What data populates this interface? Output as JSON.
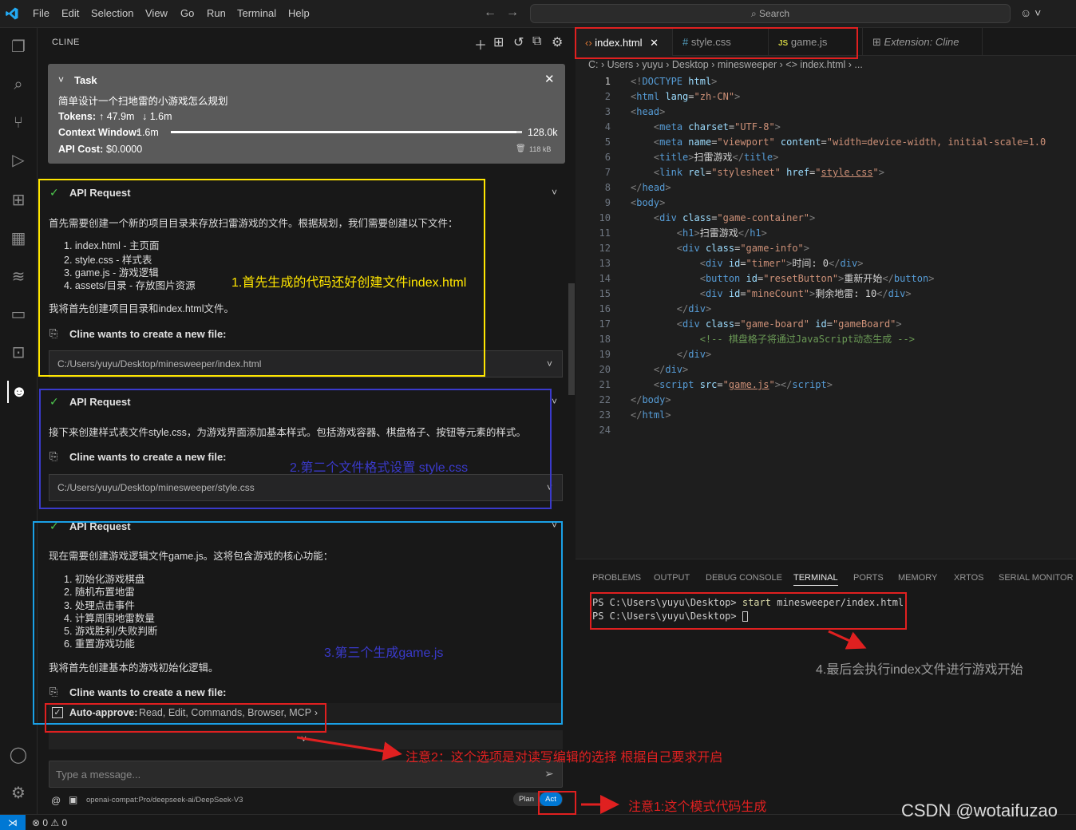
{
  "menu": [
    "File",
    "Edit",
    "Selection",
    "View",
    "Go",
    "Run",
    "Terminal",
    "Help"
  ],
  "search": {
    "label": "Search"
  },
  "sidebar": {
    "title": "CLINE"
  },
  "task": {
    "header": "Task",
    "title": "简单设计一个扫地雷的小游戏怎么规划",
    "tokens_label": "Tokens:",
    "tokens_up": "↑ 47.9m",
    "tokens_down": "↓ 1.6m",
    "context_label": "Context Window:",
    "context_used": "1.6m",
    "context_total": "128.0k",
    "context_fraction": 0.985,
    "cost_label": "API Cost:",
    "cost_value": "$0.0000",
    "size": "118 kB"
  },
  "cards": [
    {
      "title": "API Request",
      "text": "首先需要创建一个新的项目目录来存放扫雷游戏的文件。根据规划，我们需要创建以下文件：",
      "list": [
        "1. index.html - 主页面",
        "2. style.css - 样式表",
        "3. game.js - 游戏逻辑",
        "4. assets/目录 - 存放图片资源"
      ],
      "after": "我将首先创建项目目录和index.html文件。",
      "wants": "Cline wants to create a new file:",
      "path": "C:/Users/yuyu/Desktop/minesweeper/index.html"
    },
    {
      "title": "API Request",
      "text": "接下来创建样式表文件style.css，为游戏界面添加基本样式。包括游戏容器、棋盘格子、按钮等元素的样式。",
      "wants": "Cline wants to create a new file:",
      "path": "C:/Users/yuyu/Desktop/minesweeper/style.css"
    },
    {
      "title": "API Request",
      "text": "现在需要创建游戏逻辑文件game.js。这将包含游戏的核心功能：",
      "list": [
        "1. 初始化游戏棋盘",
        "2. 随机布置地雷",
        "3. 处理点击事件",
        "4. 计算周围地雷数量",
        "5. 游戏胜利/失败判断",
        "6. 重置游戏功能"
      ],
      "after": "我将首先创建基本的游戏初始化逻辑。",
      "wants": "Cline wants to create a new file:"
    }
  ],
  "autoapprove": {
    "label": "Auto-approve:",
    "items": "Read, Edit, Commands, Browser, MCP"
  },
  "chat": {
    "placeholder": "Type a message...",
    "model": "openai-compat:Pro/deepseek-ai/DeepSeek-V3",
    "plan": "Plan",
    "act": "Act",
    "at": "@"
  },
  "editor": {
    "tabs": [
      "index.html",
      "style.css",
      "game.js"
    ],
    "extension_tab": "Extension: Cline",
    "breadcrumb": "C: › Users › yuyu › Desktop › minesweeper › <> index.html › ...",
    "line_numbers": [
      "1",
      "2",
      "3",
      "4",
      "5",
      "6",
      "7",
      "8",
      "9",
      "10",
      "11",
      "12",
      "13",
      "14",
      "15",
      "16",
      "17",
      "18",
      "19",
      "20",
      "21",
      "22",
      "23",
      "24"
    ]
  },
  "panel": {
    "tabs": [
      "PROBLEMS",
      "OUTPUT",
      "DEBUG CONSOLE",
      "TERMINAL",
      "PORTS",
      "MEMORY",
      "XRTOS",
      "SERIAL MONITOR"
    ],
    "term_line1_prompt": "PS C:\\Users\\yuyu\\Desktop>",
    "term_line1_cmd": "start",
    "term_line1_arg": "minesweeper/index.html",
    "term_line2_prompt": "PS C:\\Users\\yuyu\\Desktop>"
  },
  "status": {
    "errors": "0",
    "warnings": "0"
  },
  "annotations": {
    "a1": "1.首先生成的代码还好创建文件index.html",
    "a2": "2.第二个文件格式设置 style.css",
    "a3": "3.第三个生成game.js",
    "a4": "4.最后会执行index文件进行游戏开始",
    "n2": "注意2：这个选项是对读写编辑的选择 根据自己要求开启",
    "n1": "注意1:这个模式代码生成"
  },
  "watermark": "CSDN @wotaifuzao",
  "colors": {
    "accent": "#0078d4",
    "annot_yellow": "#ffe600",
    "annot_blue": "#3a3acb",
    "annot_cyan": "#1aa0e6",
    "annot_red": "#e02020"
  }
}
